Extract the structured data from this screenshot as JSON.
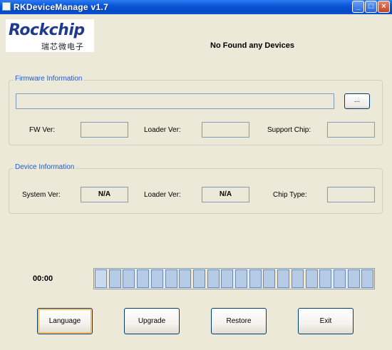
{
  "window": {
    "title": "RKDeviceManage v1.7",
    "controls": [
      "minimize-icon",
      "maximize-icon",
      "close-icon"
    ]
  },
  "logo": {
    "brand": "Rockchip",
    "subtitle": "瑞芯微电子"
  },
  "status": "No Found any Devices",
  "firmware": {
    "group_title": "Firmware Information",
    "path_value": "",
    "browse_label": "...",
    "fw_ver_label": "FW Ver:",
    "fw_ver_value": "",
    "loader_ver_label": "Loader Ver:",
    "loader_ver_value": "",
    "support_chip_label": "Support Chip:",
    "support_chip_value": ""
  },
  "device": {
    "group_title": "Device Information",
    "system_ver_label": "System Ver:",
    "system_ver_value": "N/A",
    "loader_ver_label": "Loader Ver:",
    "loader_ver_value": "N/A",
    "chip_type_label": "Chip Type:",
    "chip_type_value": ""
  },
  "progress": {
    "time": "00:00",
    "segments": 20,
    "active_segments": 1
  },
  "buttons": {
    "language": "Language",
    "upgrade": "Upgrade",
    "restore": "Restore",
    "exit": "Exit"
  },
  "colors": {
    "titlebar": "#0A57D8",
    "window_bg": "#ECE9D8",
    "group_title": "#1A5ADC",
    "logo_blue": "#1E3A8C"
  }
}
